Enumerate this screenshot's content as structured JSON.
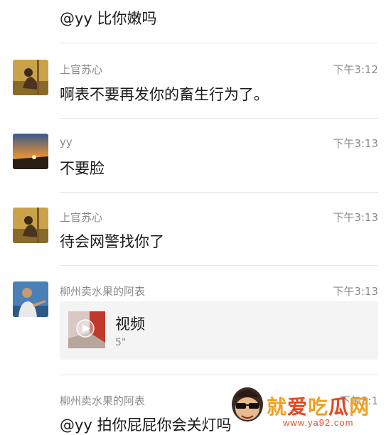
{
  "messages": [
    {
      "text": "@yy 比你嫩吗"
    },
    {
      "sender": "上官苏心",
      "time": "下午3:12",
      "text": "啊表不要再发你的畜生行为了。",
      "avatar": "person-sitting-avatar"
    },
    {
      "sender": "yy",
      "time": "下午3:13",
      "text": "不要脸",
      "avatar": "sunset-avatar"
    },
    {
      "sender": "上官苏心",
      "time": "下午3:13",
      "text": "待会网警找你了",
      "avatar": "person-sitting-avatar"
    },
    {
      "sender": "柳州卖水果的阿表",
      "time": "下午3:13",
      "avatar": "man-pointing-avatar",
      "video": {
        "title": "视频",
        "duration": "5\""
      }
    },
    {
      "sender": "柳州卖水果的阿表",
      "time": "下午3:1",
      "text": "@yy 拍你屁屁你会关灯吗"
    }
  ],
  "watermark": {
    "chars": [
      "就",
      "爱",
      "吃",
      "瓜",
      "网"
    ],
    "url": "www.ya92.com",
    "colors": [
      "#f0a020",
      "#e8451f",
      "#f0a020",
      "#e8451f",
      "#f0a020"
    ]
  }
}
